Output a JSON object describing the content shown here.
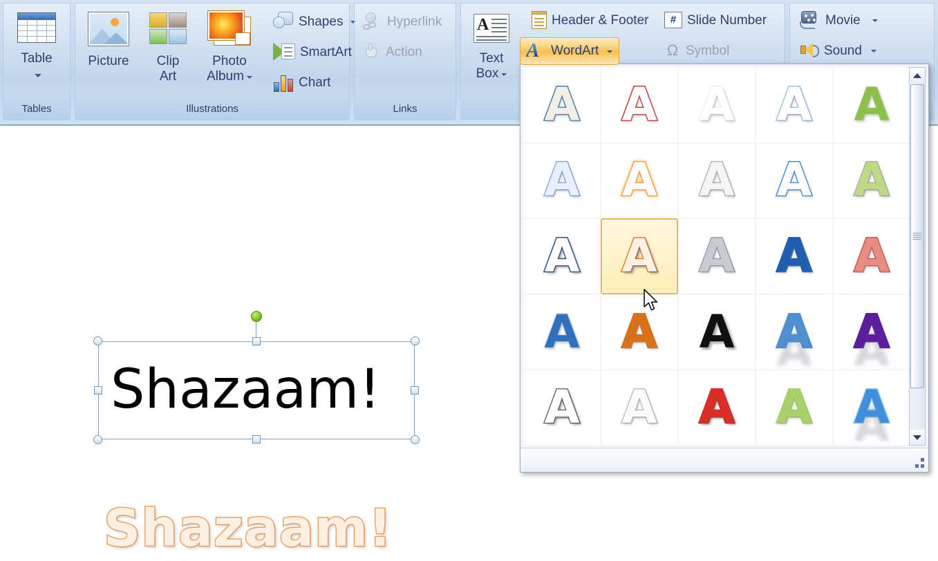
{
  "ribbon": {
    "groups": [
      {
        "name": "tables",
        "label": "Tables",
        "items": [
          {
            "label": "Table",
            "icon": "table-icon"
          }
        ]
      },
      {
        "name": "illustrations",
        "label": "Illustrations",
        "items": [
          {
            "label": "Picture",
            "icon": "picture-icon"
          },
          {
            "label": "Clip Art",
            "line1": "Clip",
            "line2": "Art",
            "icon": "clip-art-icon"
          },
          {
            "label": "Photo Album",
            "line1": "Photo",
            "line2": "Album",
            "icon": "photo-album-icon"
          },
          {
            "label": "Shapes",
            "icon": "shapes-icon"
          },
          {
            "label": "SmartArt",
            "icon": "smartart-icon"
          },
          {
            "label": "Chart",
            "icon": "chart-icon"
          }
        ]
      },
      {
        "name": "links",
        "label": "Links",
        "items": [
          {
            "label": "Hyperlink",
            "icon": "hyperlink-icon",
            "disabled": true
          },
          {
            "label": "Action",
            "icon": "action-hand-icon",
            "disabled": true
          }
        ]
      },
      {
        "name": "text",
        "label": "",
        "items": [
          {
            "label": "Text Box",
            "line1": "Text",
            "line2": "Box",
            "icon": "text-box-icon"
          },
          {
            "label": "Header & Footer",
            "icon": "header-footer-icon"
          },
          {
            "label": "WordArt",
            "icon": "wordart-icon",
            "active": true
          },
          {
            "label": "Slide Number",
            "icon": "slide-number-icon"
          },
          {
            "label": "Symbol",
            "icon": "symbol-omega-icon",
            "disabled": true
          }
        ]
      },
      {
        "name": "media-clips",
        "label": "",
        "items": [
          {
            "label": "Movie",
            "icon": "movie-icon"
          },
          {
            "label": "Sound",
            "icon": "sound-icon"
          }
        ]
      }
    ],
    "labels": {
      "table": "Table",
      "picture": "Picture",
      "clip_l1": "Clip",
      "clip_l2": "Art",
      "album_l1": "Photo",
      "album_l2": "Album",
      "shapes": "Shapes",
      "smartart": "SmartArt",
      "chart": "Chart",
      "hyperlink": "Hyperlink",
      "action": "Action",
      "textbox_l1": "Text",
      "textbox_l2": "Box",
      "header_footer": "Header & Footer",
      "wordart": "WordArt",
      "slide_number": "Slide Number",
      "symbol": "Symbol",
      "movie": "Movie",
      "sound": "Sound",
      "group_tables": "Tables",
      "group_illustrations": "Illustrations",
      "group_links": "Links",
      "slide_number_glyph": "#",
      "symbol_glyph": "Ω",
      "wordart_glyph": "A"
    }
  },
  "slide": {
    "textbox": {
      "text": "Shazaam!",
      "selected": true
    },
    "wordart_preview": {
      "text": "Shazaam!",
      "fill": "#fdf0e2",
      "outline": "#f0a262"
    }
  },
  "gallery": {
    "open": true,
    "columns": 5,
    "rows": 5,
    "glyph": "A",
    "selected_index": 11,
    "scrollbar": {
      "up_arrow": "▲",
      "down_arrow": "▼",
      "position": "middle"
    },
    "styles": [
      {
        "i": 0,
        "name": "fill-white-outline-blue",
        "fill": "#f2efe4",
        "stroke": "#4a7cb0",
        "shadow": "soft"
      },
      {
        "i": 1,
        "name": "fill-white-outline-red",
        "fill": "#ffffff",
        "stroke": "#c43b33",
        "shadow": "soft"
      },
      {
        "i": 2,
        "name": "fill-white-outline-white",
        "fill": "#ffffff",
        "stroke": "#efefef",
        "shadow": "soft"
      },
      {
        "i": 3,
        "name": "fill-white-outline-lightblue",
        "fill": "#ffffff",
        "stroke": "#9dc2e4",
        "shadow": "soft"
      },
      {
        "i": 4,
        "name": "fill-green-outline-white",
        "fill": "#8cbf4c",
        "stroke": "#f0f5e8",
        "shadow": "soft"
      },
      {
        "i": 5,
        "name": "fill-lightblue-gradient",
        "fill": "#e8f0fb",
        "stroke": "#8aa9e0",
        "shadow": "soft"
      },
      {
        "i": 6,
        "name": "fill-white-outline-orange",
        "fill": "#ffffff",
        "stroke": "#f0a145",
        "shadow": "glow"
      },
      {
        "i": 7,
        "name": "fill-white-outline-gray",
        "fill": "#f5f5f5",
        "stroke": "#b9b9b9",
        "shadow": "soft"
      },
      {
        "i": 8,
        "name": "fill-white-gradient-blue",
        "fill": "#ffffff",
        "stroke": "#3b8fe0",
        "shadow": "soft"
      },
      {
        "i": 9,
        "name": "fill-lightgreen-outline-gray",
        "fill": "#bcd984",
        "stroke": "#b0b4a8",
        "shadow": "soft"
      },
      {
        "i": 10,
        "name": "fill-white-outline-navy",
        "fill": "#ffffff",
        "stroke": "#1f4f8f",
        "shadow": "strong"
      },
      {
        "i": 11,
        "name": "fill-white-outline-orange-sel",
        "fill": "#fdf1e4",
        "stroke": "#ed7d22",
        "shadow": "strong"
      },
      {
        "i": 12,
        "name": "fill-silver-gradient",
        "fill": "#c8ccd0",
        "stroke": "#9aa0a6",
        "shadow": "soft"
      },
      {
        "i": 13,
        "name": "fill-blue-solid",
        "fill": "#1f5fae",
        "stroke": "#1f5fae",
        "shadow": "soft"
      },
      {
        "i": 14,
        "name": "fill-salmon-striped",
        "fill": "#e98c84",
        "stroke": "#c8554c",
        "shadow": "soft"
      },
      {
        "i": 15,
        "name": "fill-blue-outline-lightblue",
        "fill": "#2f6fbb",
        "stroke": "#cfe2f5",
        "shadow": "soft"
      },
      {
        "i": 16,
        "name": "fill-darkorange-solid",
        "fill": "#d8711a",
        "stroke": "#d8711a",
        "shadow": "soft"
      },
      {
        "i": 17,
        "name": "fill-black-outline-white",
        "fill": "#111111",
        "stroke": "#ffffff",
        "shadow": "strong"
      },
      {
        "i": 18,
        "name": "fill-blue-gradient-reflect",
        "fill": "#4f8fd0",
        "stroke": "#4f8fd0",
        "shadow": "reflect"
      },
      {
        "i": 19,
        "name": "fill-purple-gradient-reflect",
        "fill": "#5b1f9e",
        "stroke": "#5b1f9e",
        "shadow": "reflect"
      },
      {
        "i": 20,
        "name": "fill-white-outline-darkgray",
        "fill": "#ffffff",
        "stroke": "#6d6d6d",
        "shadow": "strong"
      },
      {
        "i": 21,
        "name": "fill-white-outline-silver",
        "fill": "#fafafa",
        "stroke": "#c0c0c0",
        "shadow": "soft"
      },
      {
        "i": 22,
        "name": "fill-red-solid",
        "fill": "#dd2b26",
        "stroke": "#dd2b26",
        "shadow": "strong"
      },
      {
        "i": 23,
        "name": "fill-lightgreen-solid",
        "fill": "#a9d169",
        "stroke": "#a9d169",
        "shadow": "soft"
      },
      {
        "i": 24,
        "name": "fill-blue-striped-reflect",
        "fill": "#3f8fdd",
        "stroke": "#8fc4ef",
        "shadow": "reflect"
      }
    ]
  }
}
